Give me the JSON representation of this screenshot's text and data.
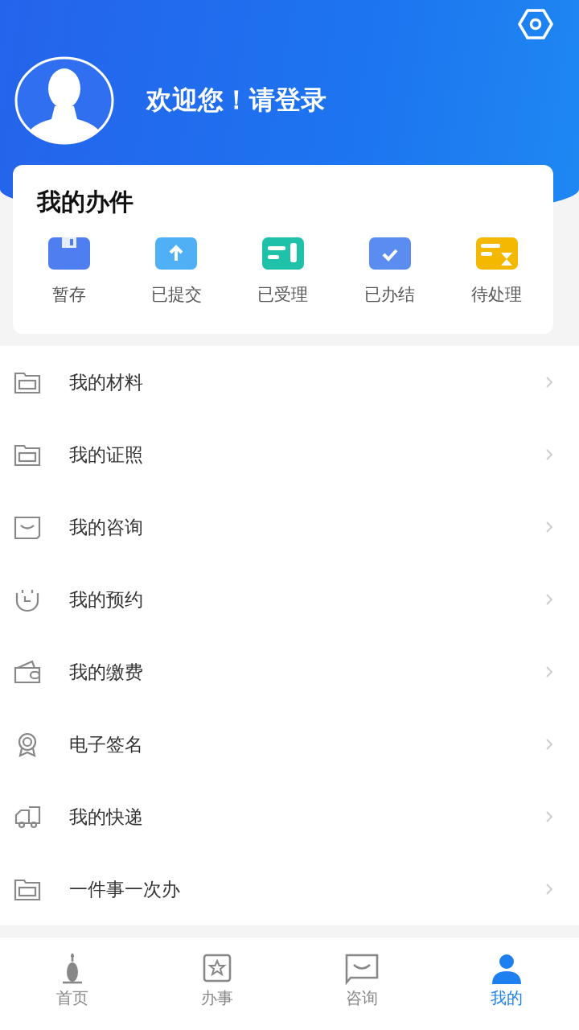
{
  "header": {
    "greeting": "欢迎您！请登录"
  },
  "my_cases": {
    "title": "我的办件",
    "items": [
      {
        "label": "暂存"
      },
      {
        "label": "已提交"
      },
      {
        "label": "已受理"
      },
      {
        "label": "已办结"
      },
      {
        "label": "待处理"
      }
    ]
  },
  "menu": [
    {
      "label": "我的材料"
    },
    {
      "label": "我的证照"
    },
    {
      "label": "我的咨询"
    },
    {
      "label": "我的预约"
    },
    {
      "label": "我的缴费"
    },
    {
      "label": "电子签名"
    },
    {
      "label": "我的快递"
    },
    {
      "label": "一件事一次办"
    }
  ],
  "tabs": [
    {
      "label": "首页",
      "selected": false
    },
    {
      "label": "办事",
      "selected": false
    },
    {
      "label": "咨询",
      "selected": false
    },
    {
      "label": "我的",
      "selected": true
    }
  ]
}
